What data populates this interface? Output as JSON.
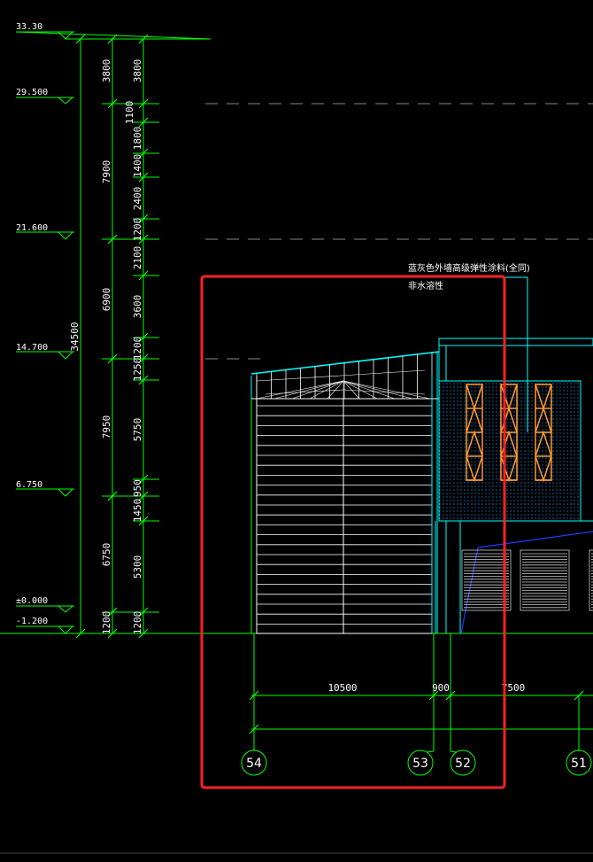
{
  "colors": {
    "background": "#000000",
    "dimension_line": "#00ff00",
    "building_outline": "#00ffff",
    "window_frame": "#ff9933",
    "highlight_box": "#ff2222",
    "blue_line": "#1e3cff",
    "glass_dots": "#1aa0ff",
    "text": "#ffffff",
    "door": "#cccccc"
  },
  "levels": [
    "33.30",
    "29.500",
    "21.600",
    "14.700",
    "6.750",
    "±0.000",
    "-1.200"
  ],
  "dimensions": {
    "total_height": "34500",
    "column_a": [
      "3800",
      "7900",
      "6900",
      "7950",
      "6750",
      "1200"
    ],
    "column_b_upper": [
      "1100",
      "1800",
      "1400",
      "2400",
      "1200",
      "2100",
      "3600",
      "1200",
      "1250",
      "5750",
      "950",
      "1450",
      "5300",
      "1200"
    ],
    "column_b_top": "3800",
    "horizontal": [
      "10500",
      "900",
      "7500"
    ]
  },
  "note": {
    "line1": "蓝灰色外墙高级弹性涂料(全同)",
    "line2": "非水溶性"
  },
  "axes": [
    "54",
    "53",
    "52",
    "51"
  ]
}
